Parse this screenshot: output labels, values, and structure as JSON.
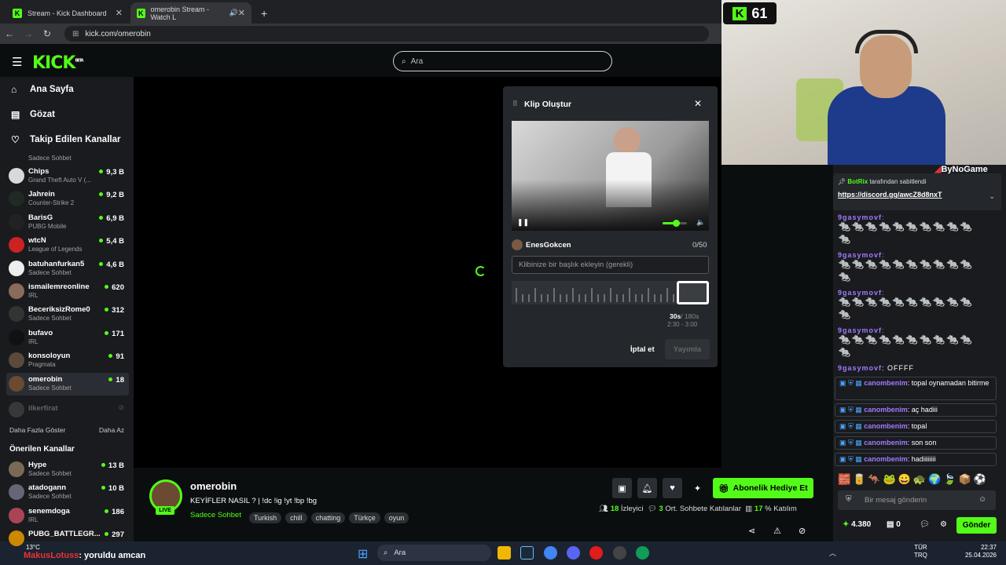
{
  "browser": {
    "tabs": [
      {
        "title": "Stream - Kick Dashboard"
      },
      {
        "title": "omerobin Stream - Watch L"
      }
    ],
    "url": "kick.com/omerobin"
  },
  "topbar": {
    "logo": "KICK",
    "logo_sup": "BETA",
    "search_placeholder": "Ara"
  },
  "sidebar": {
    "nav": [
      {
        "label": "Ana Sayfa",
        "icon": "home-icon"
      },
      {
        "label": "Gözat",
        "icon": "browse-icon"
      },
      {
        "label": "Takip Edilen Kanallar",
        "icon": "heart-icon"
      }
    ],
    "partial_top": "Sadece Sohbet",
    "followed": [
      {
        "name": "Chips",
        "game": "Grand Theft Auto V (...",
        "viewers": "9,3 B",
        "color": "#d9d9d9"
      },
      {
        "name": "Jahrein",
        "game": "Counter-Strike 2",
        "viewers": "9,2 B",
        "color": "#1e2a22"
      },
      {
        "name": "BarisG",
        "game": "PUBG Mobile",
        "viewers": "6,9 B",
        "color": "#222"
      },
      {
        "name": "wtcN",
        "game": "League of Legends",
        "viewers": "5,4 B",
        "color": "#c22"
      },
      {
        "name": "batuhanfurkan5",
        "game": "Sadece Sohbet",
        "viewers": "4,6 B",
        "color": "#eee"
      },
      {
        "name": "ismailemreonline",
        "game": "IRL",
        "viewers": "620",
        "color": "#8a6a5a"
      },
      {
        "name": "BeceriksizRome0",
        "game": "Sadece Sohbet",
        "viewers": "312",
        "color": "#333"
      },
      {
        "name": "bufavo",
        "game": "IRL",
        "viewers": "171",
        "color": "#111"
      },
      {
        "name": "konsoloyun",
        "game": "Pragmata",
        "viewers": "91",
        "color": "#5b4a3b"
      },
      {
        "name": "omerobin",
        "game": "Sadece Sohbet",
        "viewers": "18",
        "color": "#6b4a32"
      }
    ],
    "offline_channel": "ilkerfirat",
    "show_more": "Daha Fazla Göster",
    "show_less": "Daha Az",
    "recommended_title": "Önerilen Kanallar",
    "recommended": [
      {
        "name": "Hype",
        "game": "Sadece Sohbet",
        "viewers": "13 B",
        "color": "#7a6a55"
      },
      {
        "name": "atadogann",
        "game": "Sadece Sohbet",
        "viewers": "10 B",
        "color": "#667"
      },
      {
        "name": "senemdoga",
        "game": "IRL",
        "viewers": "186",
        "color": "#a45"
      },
      {
        "name": "PUBG_BATTLEGR...",
        "game": "",
        "viewers": "297",
        "color": "#c80"
      }
    ]
  },
  "clip_modal": {
    "title": "Klip Oluştur",
    "username": "EnesGokcen",
    "char_count": "0/50",
    "placeholder": "Klibinize bir başlık ekleyin (gerekli)",
    "duration": "30s",
    "duration_max": "/ 180s",
    "range": "2:30 - 3:00",
    "cancel": "İptal et",
    "publish": "Yayımla",
    "volume": 0.55
  },
  "stream": {
    "channel": "omerobin",
    "title": "KEYİFLER NASIL ? | !dc !ig !yt !bp !bg",
    "category": "Sadece Sohbet",
    "tags": [
      "Turkish",
      "chill",
      "chatting",
      "Türkçe",
      "oyun"
    ],
    "live_label": "LIVE",
    "gift_label": "Abonelik Hediye Et",
    "viewers": "18",
    "viewers_label": "İzleyici",
    "chatters": "3",
    "chatters_label": "Ort. Sohbete Katılanlar",
    "participation": "17",
    "participation_label": "% Katılım"
  },
  "overlay": {
    "kick_count": "61",
    "brand": "ByNoGame"
  },
  "chat": {
    "pinned_by": "BotRix",
    "pinned_text": "tarafından sabitlendi",
    "pinned_link": "https://discord.gg/awcZ8d8nxT",
    "spam_user": "9gasymovf",
    "spam_last": "OFFFF",
    "messages": [
      {
        "user": "canombenim",
        "text": "topal oynamadan bitirme"
      },
      {
        "user": "canombenim",
        "text": "aç hadiii"
      },
      {
        "user": "canombenim",
        "text": "topal"
      },
      {
        "user": "canombenim",
        "text": "son son"
      },
      {
        "user": "canombenim",
        "text": "hadiiiiiiii"
      }
    ],
    "input_placeholder": "Bir mesaj gönderin",
    "points": "4.380",
    "gifts": "0",
    "send": "Gönder"
  },
  "bottom_overlay": {
    "user": "MakusLotuss",
    "text": ": yoruldu amcan"
  },
  "taskbar": {
    "weather": "13°C",
    "search": "Ara",
    "lang": "TÜR",
    "lang2": "TRQ",
    "time": "22:37",
    "date": "25.04.2026"
  }
}
